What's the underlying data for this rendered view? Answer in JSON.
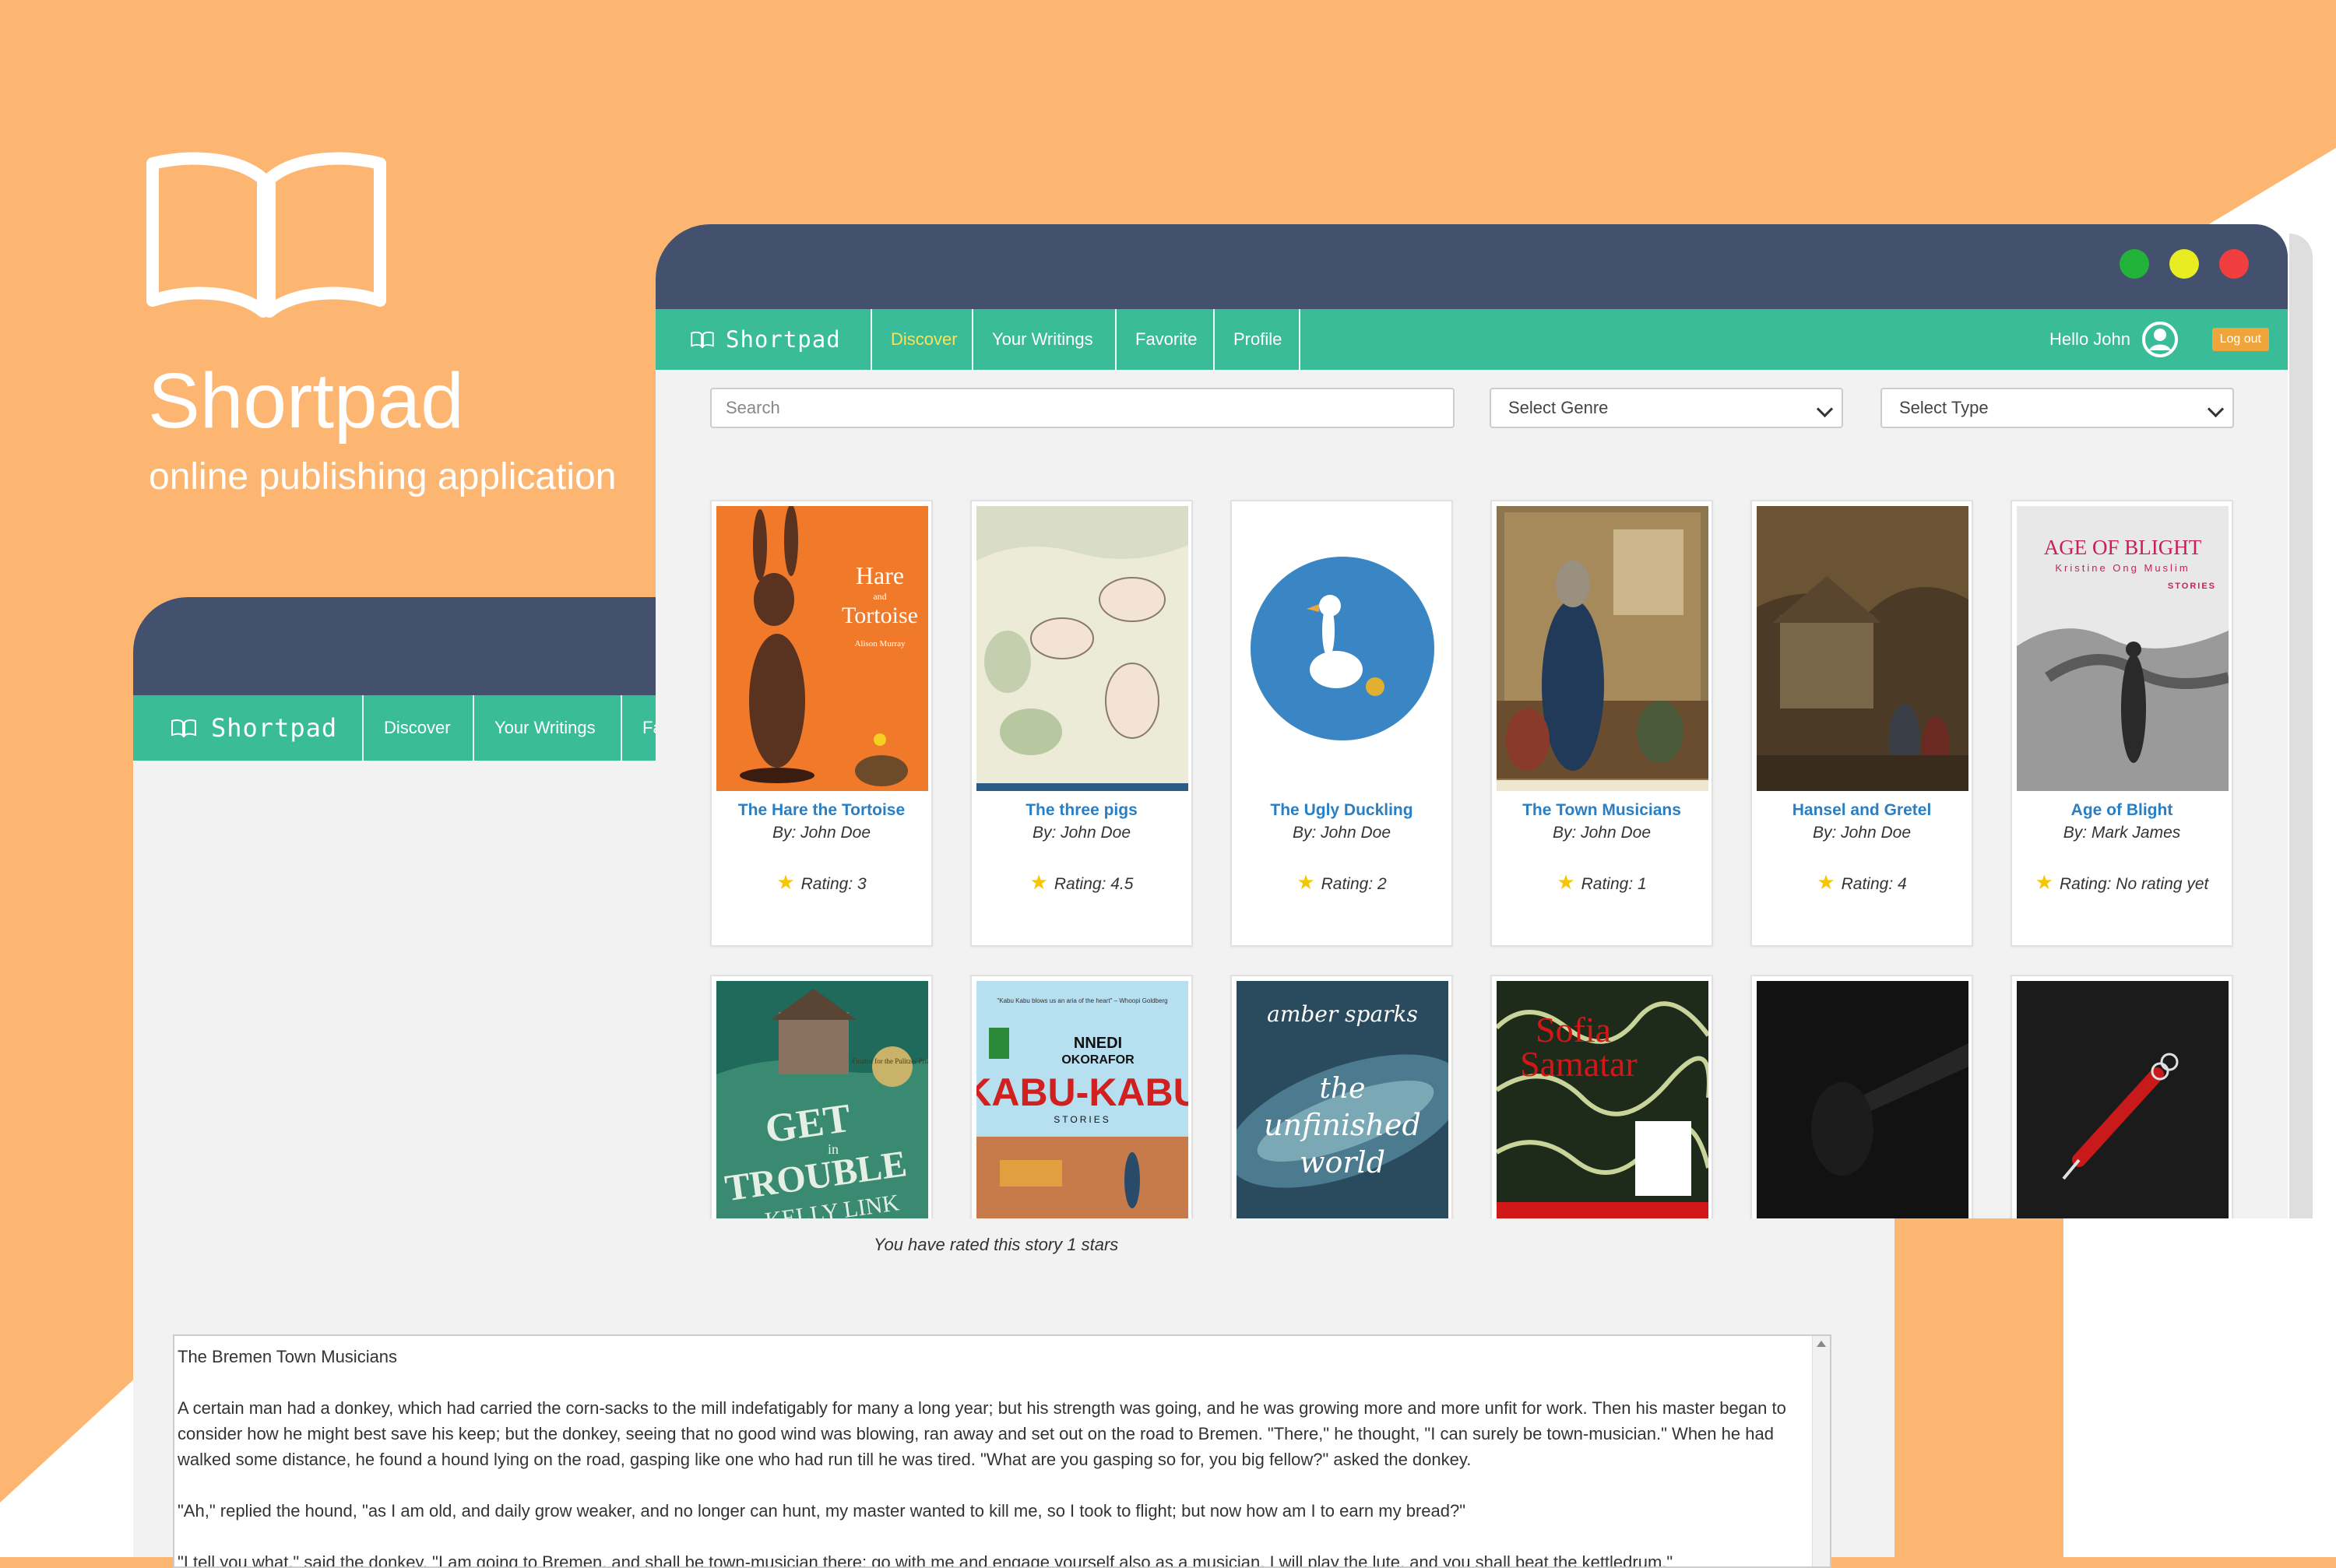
{
  "promo": {
    "app_name": "Shortpad",
    "tagline": "online publishing application"
  },
  "back_window": {
    "nav": {
      "brand": "Shortpad",
      "items": [
        "Discover",
        "Your Writings",
        "Fa"
      ]
    },
    "rating_message": "You have rated this story 1 stars",
    "story": {
      "title": "The Bremen Town Musicians",
      "paragraphs": [
        "A certain man had a donkey, which had carried the corn-sacks to the mill indefatigably for many a long year; but his strength was going, and he was growing more and more unfit for work. Then his master began to consider how he might best save his keep; but the donkey, seeing that no good wind was blowing, ran away and set out on the road to Bremen. \"There,\" he thought, \"I can surely be town-musician.\" When he had walked some distance, he found a hound lying on the road, gasping like one who had run till he was tired. \"What are you gasping so for, you big fellow?\" asked the donkey.",
        "\"Ah,\" replied the hound, \"as I am old, and daily grow weaker, and no longer can hunt, my master wanted to kill me, so I took to flight; but now how am I to earn my bread?\"",
        "\"I tell you what,\" said the donkey, \"I am going to Bremen, and shall be town-musician there; go with me and engage yourself also as a musician. I will play the lute, and you shall beat the kettledrum.\""
      ]
    }
  },
  "front_window": {
    "nav": {
      "brand": "Shortpad",
      "items": [
        "Discover",
        "Your Writings",
        "Favorite",
        "Profile"
      ],
      "active": "Discover",
      "greeting": "Hello John",
      "logout": "Log out"
    },
    "filters": {
      "search_placeholder": "Search",
      "genre": "Select Genre",
      "type": "Select Type"
    },
    "books": [
      {
        "title": "The Hare the Tortoise",
        "author": "By: John Doe",
        "rating": "Rating: 3",
        "cover_text": [
          "Hare",
          "and",
          "Tortoise",
          "Alison Murray"
        ]
      },
      {
        "title": "The three pigs",
        "author": "By: John Doe",
        "rating": "Rating: 4.5"
      },
      {
        "title": "The Ugly Duckling",
        "author": "By: John Doe",
        "rating": "Rating: 2"
      },
      {
        "title": "The Town Musicians",
        "author": "By: John Doe",
        "rating": "Rating: 1"
      },
      {
        "title": "Hansel and Gretel",
        "author": "By: John Doe",
        "rating": "Rating: 4"
      },
      {
        "title": "Age of Blight",
        "author": "By: Mark James",
        "rating": "Rating: No rating yet",
        "cover_text": [
          "AGE OF BLIGHT",
          "Kristine Ong Muslim",
          "STORIES"
        ]
      },
      {
        "cover_text": [
          "GET",
          "in",
          "TROUBLE",
          "KELLY LINK",
          "Finalist for the Pulitzer Prize"
        ]
      },
      {
        "cover_text": [
          "NNEDI",
          "OKORAFOR",
          "KABU-KABU",
          "STORIES",
          "\"Kabu Kabu blows us an aria of the heart\" – Whoopi Goldberg"
        ]
      },
      {
        "cover_text": [
          "amber sparks",
          "the",
          "unfinished",
          "world"
        ]
      },
      {
        "cover_text": [
          "Sofia",
          "Samatar"
        ]
      },
      {},
      {}
    ]
  },
  "colors": {
    "background": "#fdb672",
    "titlebar": "#43506e",
    "navbar": "#3bbc98",
    "active_nav": "#f7e25a",
    "link": "#2a7fc4",
    "star": "#f7c600",
    "logout": "#f0a53b"
  }
}
